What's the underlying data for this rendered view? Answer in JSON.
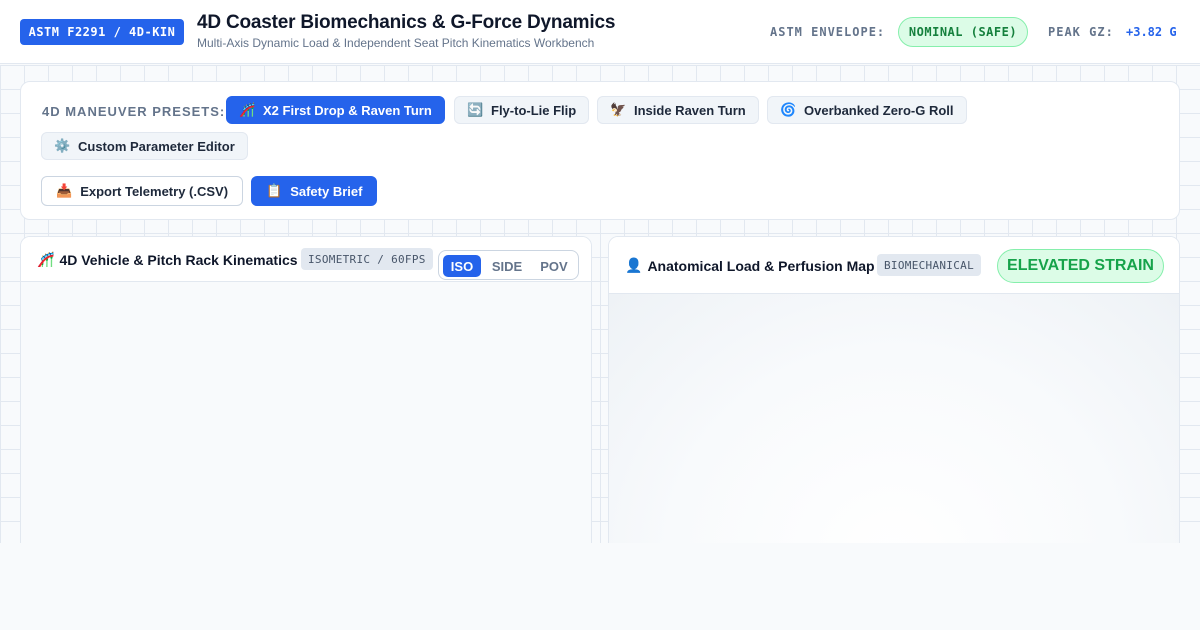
{
  "header": {
    "standard_badge": "ASTM F2291 / 4D-KIN",
    "title": "4D Coaster Biomechanics & G-Force Dynamics",
    "subtitle": "Multi-Axis Dynamic Load & Independent Seat Pitch Kinematics Workbench",
    "envelope_label": "ASTM ENVELOPE:",
    "envelope_status": "NOMINAL (SAFE)",
    "peak_label": "PEAK GZ:",
    "peak_value": "+3.82 G"
  },
  "presets": {
    "label": "4D MANEUVER PRESETS:",
    "items": [
      {
        "icon": "roller-coaster-icon",
        "glyph": "🎢",
        "label": "X2 First Drop & Raven Turn",
        "active": true
      },
      {
        "icon": "flip-arrows-icon",
        "glyph": "🔄",
        "label": "Fly-to-Lie Flip",
        "active": false
      },
      {
        "icon": "eagle-icon",
        "glyph": "🦅",
        "label": "Inside Raven Turn",
        "active": false
      },
      {
        "icon": "spiral-icon",
        "glyph": "🌀",
        "label": "Overbanked Zero-G Roll",
        "active": false
      },
      {
        "icon": "gear-icon",
        "glyph": "⚙️",
        "label": "Custom Parameter Editor",
        "active": false
      }
    ],
    "actions": [
      {
        "icon": "inbox-tray-icon",
        "glyph": "📥",
        "label": "Export Telemetry (.CSV)"
      },
      {
        "icon": "clipboard-icon",
        "glyph": "📋",
        "label": "Safety Brief"
      }
    ]
  },
  "kinematics_panel": {
    "icon": "roller-coaster-icon",
    "glyph": "🎢",
    "title": "4D Vehicle & Pitch Rack Kinematics",
    "tag": "ISOMETRIC / 60FPS",
    "views": [
      "ISO",
      "SIDE",
      "POV"
    ],
    "active_view": "ISO"
  },
  "anatomy_panel": {
    "icon": "person-silhouette-icon",
    "glyph": "👤",
    "title": "Anatomical Load & Perfusion Map",
    "tag": "BIOMECHANICAL",
    "status": "ELEVATED STRAIN"
  },
  "colors": {
    "accent": "#2563eb",
    "safe_bg": "#dcfce7",
    "safe_text": "#15803d",
    "muted_text": "#64748b"
  }
}
